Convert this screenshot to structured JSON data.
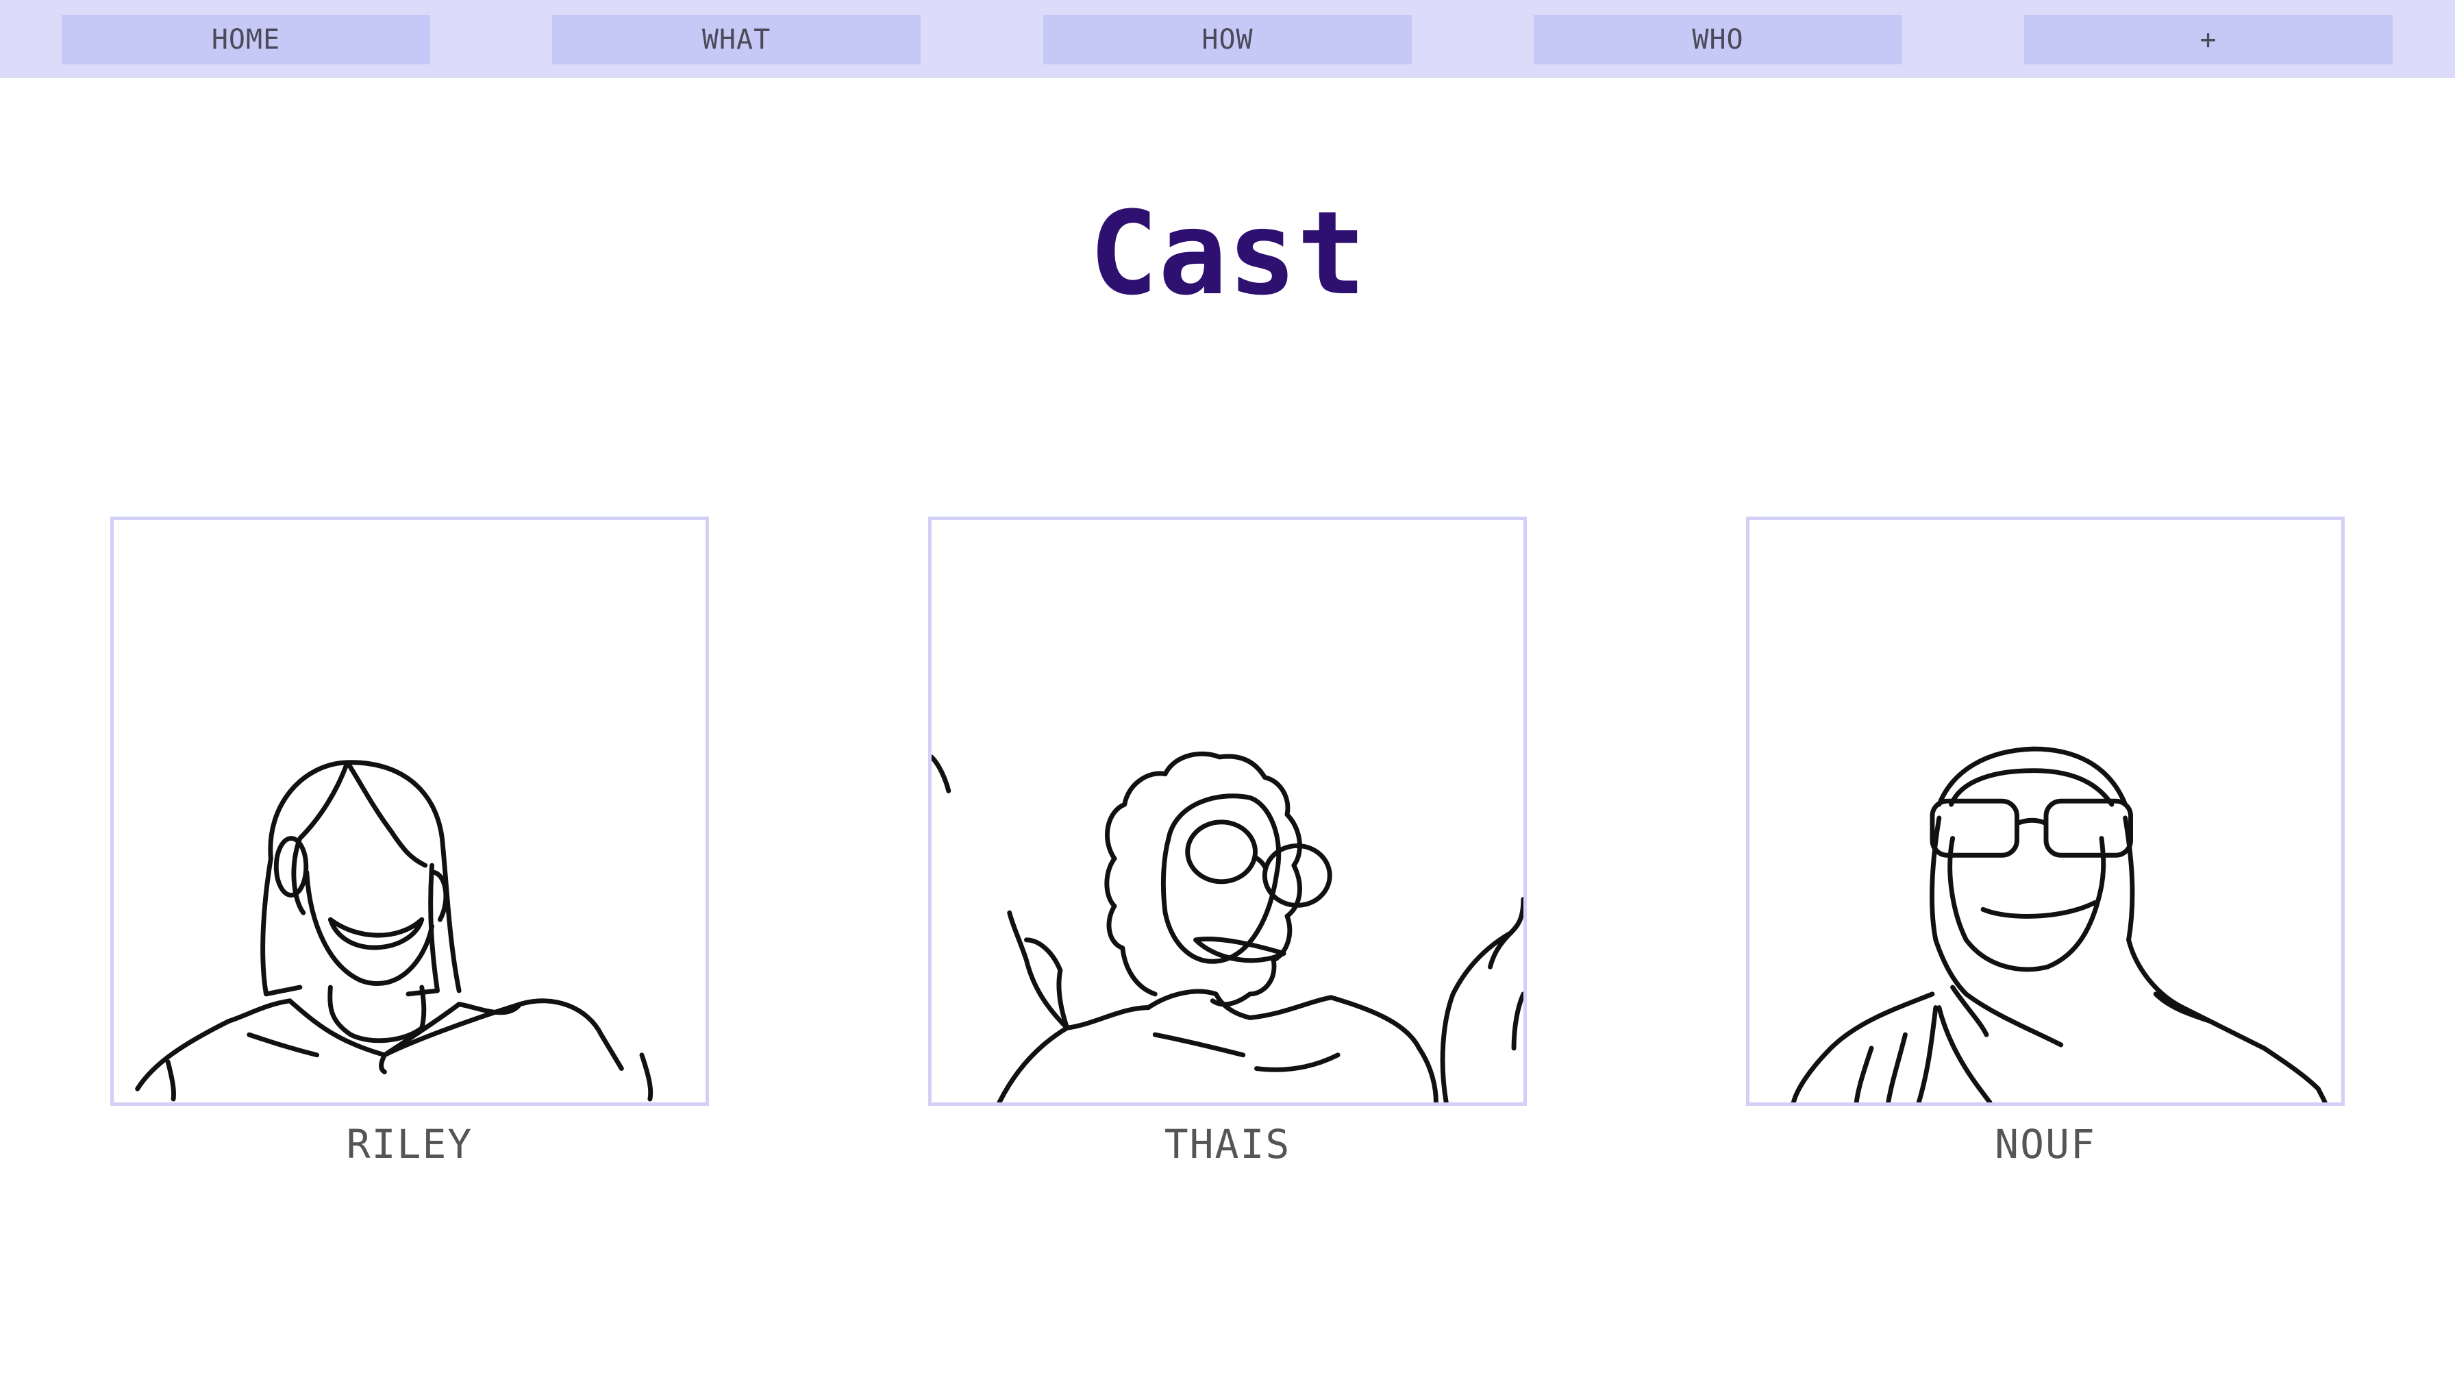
{
  "nav": {
    "items": [
      {
        "label": "HOME"
      },
      {
        "label": "WHAT"
      },
      {
        "label": "HOW"
      },
      {
        "label": "WHO"
      },
      {
        "label": "+"
      }
    ]
  },
  "page": {
    "title": "Cast"
  },
  "cast": [
    {
      "name": "RILEY",
      "icon": "portrait-line-drawing"
    },
    {
      "name": "THAIS",
      "icon": "portrait-line-drawing"
    },
    {
      "name": "NOUF",
      "icon": "portrait-line-drawing"
    }
  ],
  "colors": {
    "nav_background": "#dcdcfa",
    "nav_button": "#c6c9f6",
    "title": "#2e1070",
    "frame_border": "#d2d0f6",
    "name_text": "#555555"
  }
}
